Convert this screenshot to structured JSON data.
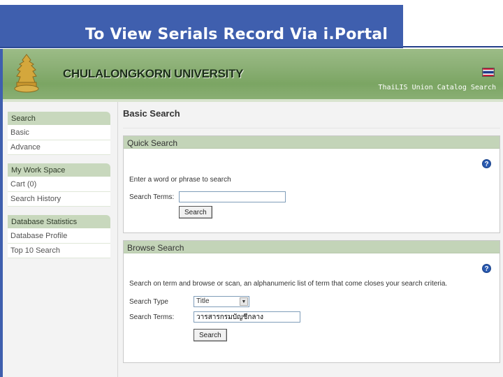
{
  "slide": {
    "title": "To View Serials Record Via i.Portal"
  },
  "banner": {
    "university": "CHULALONGKORN UNIVERSITY",
    "catalog": "ThaiLIS Union Catalog Search"
  },
  "sidebar": {
    "groups": [
      {
        "title": "Search",
        "items": [
          "Basic",
          "Advance"
        ]
      },
      {
        "title": "My Work Space",
        "items": [
          "Cart (0)",
          "Search History"
        ]
      },
      {
        "title": "Database Statistics",
        "items": [
          "Database Profile",
          "Top 10 Search"
        ]
      }
    ]
  },
  "main": {
    "title": "Basic Search",
    "quick": {
      "heading": "Quick Search",
      "instruction": "Enter a word or phrase to search",
      "terms_label": "Search Terms:",
      "terms_value": "",
      "button": "Search"
    },
    "browse": {
      "heading": "Browse Search",
      "instruction": "Search on term and browse or scan, an alphanumeric list of term that come closes your search criteria.",
      "type_label": "Search Type",
      "type_value": "Title",
      "terms_label": "Search Terms:",
      "terms_value": "วารสารกรมบัญชีกลาง",
      "button": "Search"
    }
  },
  "icons": {
    "help": "?"
  },
  "colors": {
    "title_bar": "#3f5fae",
    "banner": "#8cb076",
    "panel_head": "#c3d4b8"
  }
}
